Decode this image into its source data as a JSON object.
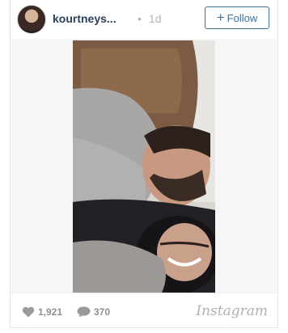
{
  "header": {
    "username": "kourtneys...",
    "separator": "•",
    "age": "1d",
    "follow_plus": "+",
    "follow_label": "Follow"
  },
  "footer": {
    "likes": "1,921",
    "comments": "370",
    "brand": "Instagram"
  },
  "icons": {
    "like": "heart-icon",
    "comment": "comment-bubble-icon",
    "follow": "plus-icon"
  },
  "colors": {
    "username": "#27415c",
    "follow_accent": "#3f729b",
    "meta_gray": "#8f8f8f"
  }
}
